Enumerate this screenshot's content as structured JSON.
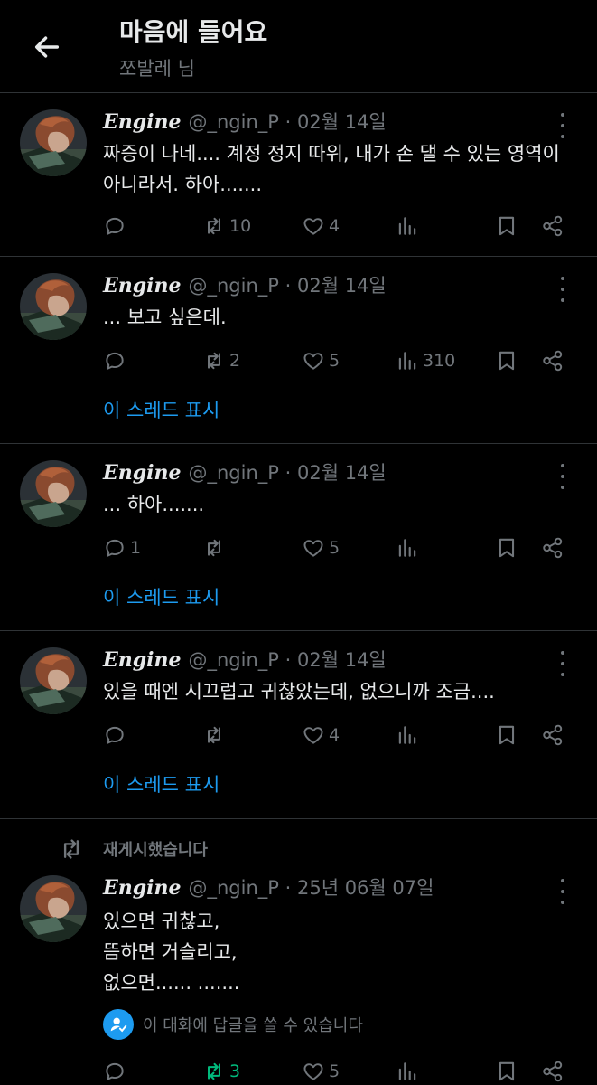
{
  "header": {
    "title": "마음에 들어요",
    "subtitle": "쪼발레 님"
  },
  "posts": [
    {
      "name": "Engine",
      "handle": "@_ngin_P · 02월 14일",
      "text": [
        "짜증이 나네.... 계정 정지 따위, 내가 손 댈 수 있는 영역이",
        "아니라서. 하아......."
      ],
      "reply": "",
      "repost": "10",
      "like": "4",
      "views": ""
    },
    {
      "name": "Engine",
      "handle": "@_ngin_P · 02월 14일",
      "text": [
        "... 보고 싶은데."
      ],
      "reply": "",
      "repost": "2",
      "like": "5",
      "views": "310",
      "thread": "이 스레드 표시"
    },
    {
      "name": "Engine",
      "handle": "@_ngin_P · 02월 14일",
      "text": [
        "... 하아......."
      ],
      "reply": "1",
      "repost": "",
      "like": "5",
      "views": "",
      "thread": "이 스레드 표시"
    },
    {
      "name": "Engine",
      "handle": "@_ngin_P · 02월 14일",
      "text": [
        "있을 때엔 시끄럽고 귀찮았는데, 없으니까 조금...."
      ],
      "reply": "",
      "repost": "",
      "like": "4",
      "views": "",
      "thread": "이 스레드 표시"
    },
    {
      "name": "Engine",
      "handle": "@_ngin_P · 25년 06월 07일",
      "text": [
        "있으면 귀찮고,",
        "뜸하면 거슬리고,",
        "없으면...... .......",
        "이 대화에 답글을 쓸 수 있습니다"
      ],
      "reply": "",
      "repost": "3",
      "like": "5",
      "views": ""
    }
  ],
  "repost_label": "재게시했습니다",
  "colors": {
    "background": "#000000",
    "text": "#e7e9ea",
    "muted": "#71767b",
    "accent": "#1d9bf0",
    "repost_active": "#00ba7c",
    "divider": "#2f3336"
  },
  "icons": [
    "back-arrow-icon",
    "more-icon",
    "reply-icon",
    "repost-icon",
    "like-icon",
    "views-icon",
    "bookmark-icon",
    "share-icon",
    "reply-restriction-icon"
  ]
}
